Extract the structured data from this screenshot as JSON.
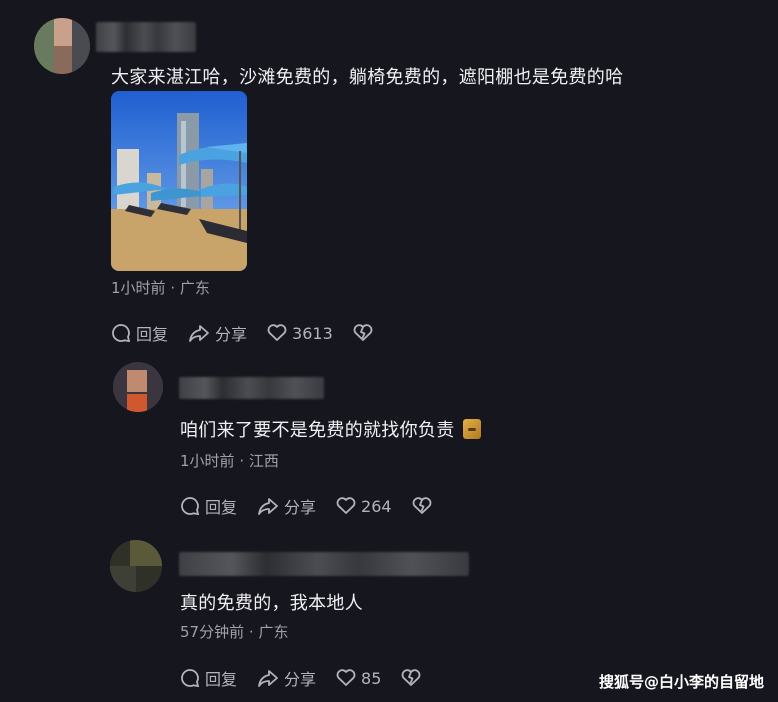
{
  "comments": [
    {
      "text": "大家来湛江哈，沙滩免费的，躺椅免费的，遮阳棚也是免费的哈",
      "time": "1小时前",
      "location": "广东",
      "reply_label": "回复",
      "share_label": "分享",
      "likes": "3613"
    },
    {
      "text": "咱们来了要不是免费的就找你负责",
      "time": "1小时前",
      "location": "江西",
      "reply_label": "回复",
      "share_label": "分享",
      "likes": "264"
    },
    {
      "text": "真的免费的，我本地人",
      "time": "57分钟前",
      "location": "广东",
      "reply_label": "回复",
      "share_label": "分享",
      "likes": "85"
    }
  ],
  "separator": "·",
  "watermark": "搜狐号@白小李的自留地",
  "colors": {
    "background": "#16161e",
    "text": "#f0f0f4",
    "meta": "#a0a1a8",
    "sky": "#2f6fd6",
    "umbrella": "#4aa3e0",
    "sand": "#c9a46a"
  }
}
